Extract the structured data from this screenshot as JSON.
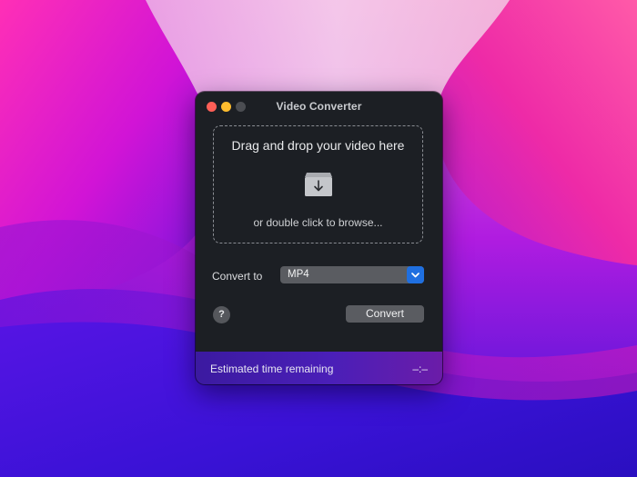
{
  "window": {
    "title": "Video Converter"
  },
  "dropzone": {
    "title": "Drag and drop your video here",
    "subtitle": "or double click to browse...",
    "icon": "download-box-icon"
  },
  "conversion": {
    "label": "Convert to",
    "format_value": "MP4",
    "help_label": "?",
    "convert_label": "Convert"
  },
  "status": {
    "label": "Estimated time remaining",
    "value": "–:–"
  },
  "colors": {
    "close": "#ff5f57",
    "minimize": "#febc2e",
    "zoom_inactive": "#4b4d52",
    "accent": "#1f6fe0",
    "window_bg": "#1c1f24"
  }
}
